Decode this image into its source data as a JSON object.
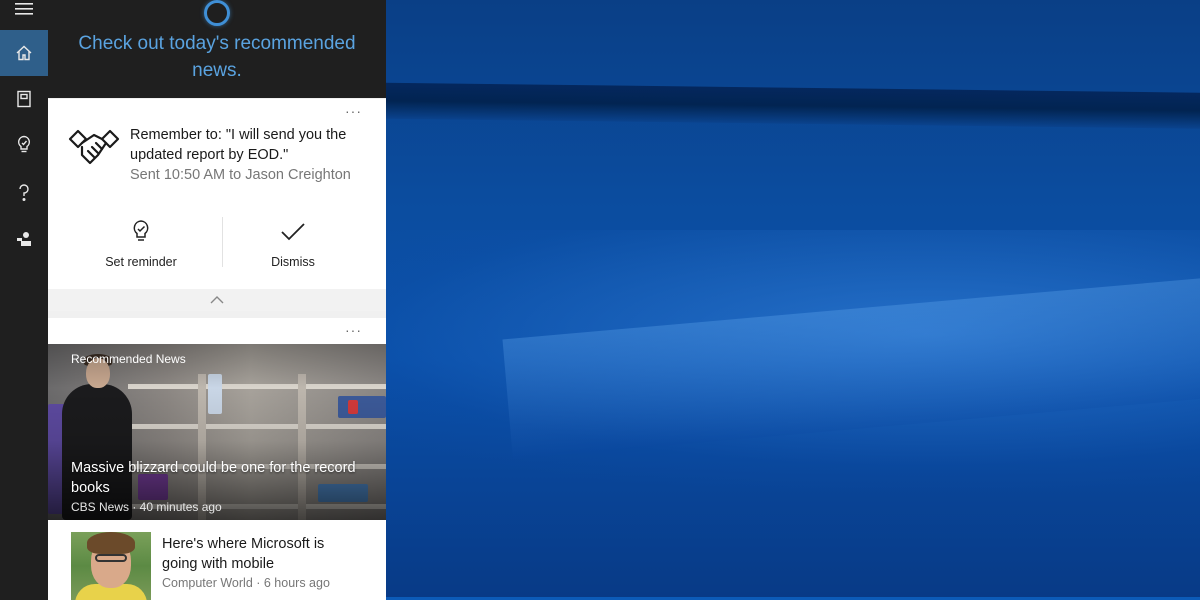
{
  "cortana": {
    "greeting": "Check out today's recommended news."
  },
  "rail": {
    "items": [
      {
        "name": "hamburger-menu-icon"
      },
      {
        "name": "home-icon"
      },
      {
        "name": "notebook-icon"
      },
      {
        "name": "lightbulb-reminder-icon"
      },
      {
        "name": "help-icon"
      },
      {
        "name": "feedback-icon"
      }
    ]
  },
  "reminder_card": {
    "more": "···",
    "text": "Remember to: \"I will send you the updated report by EOD.\"",
    "sub": "Sent 10:50 AM to Jason Creighton",
    "actions": {
      "set_reminder": "Set reminder",
      "dismiss": "Dismiss"
    }
  },
  "news_card": {
    "more": "···",
    "category": "Recommended News",
    "hero": {
      "title": "Massive blizzard could be one for the record books",
      "meta": "CBS News · 40 minutes ago"
    },
    "item": {
      "title": "Here's where Microsoft is going with mobile",
      "meta": "Computer World · 6 hours ago"
    }
  },
  "colors": {
    "accent": "#5aa3e0",
    "rail_bg": "#1f1f1f",
    "rail_active": "#2f5f8a",
    "desktop": "#0b4da0"
  }
}
